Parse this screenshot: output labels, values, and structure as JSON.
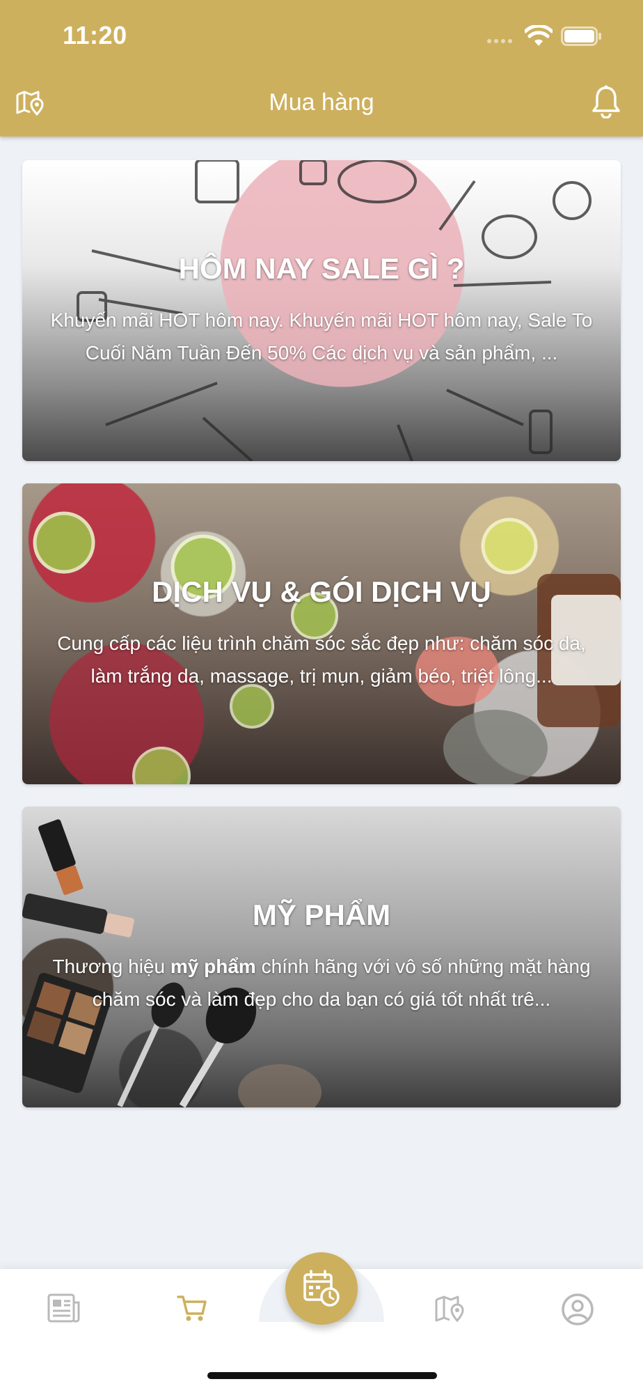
{
  "status_bar": {
    "time": "11:20"
  },
  "header": {
    "title": "Mua hàng"
  },
  "cards": [
    {
      "title": "HÔM NAY SALE GÌ ?",
      "description": "Khuyến mãi HOT hôm nay. Khuyến mãi HOT hôm nay, Sale To Cuối Năm Tuần Đến 50% Các dịch vụ và sản phẩm, ..."
    },
    {
      "title": "DỊCH VỤ & GÓI DỊCH VỤ",
      "description": "Cung cấp các liệu trình chăm sóc sắc đẹp như: chăm sóc da, làm trắng da, massage, trị mụn, giảm béo, triệt lông..."
    },
    {
      "title": "MỸ PHẨM",
      "description_prefix": "Thương hiệu ",
      "description_bold": "mỹ phẩm",
      "description_suffix": " chính hãng với vô số những mặt hàng chăm sóc và làm đẹp cho da bạn có giá tốt nhất trê..."
    }
  ],
  "tabbar": {
    "tabs": [
      {
        "icon": "newspaper-icon",
        "active": false
      },
      {
        "icon": "cart-icon",
        "active": true
      },
      {
        "icon": "calendar-clock-icon",
        "active": false,
        "center": true
      },
      {
        "icon": "map-pin-icon",
        "active": false
      },
      {
        "icon": "user-icon",
        "active": false
      }
    ]
  },
  "colors": {
    "brand": "#cdb05e",
    "background": "#eef2f6",
    "tab_inactive": "#b9b9b9"
  }
}
